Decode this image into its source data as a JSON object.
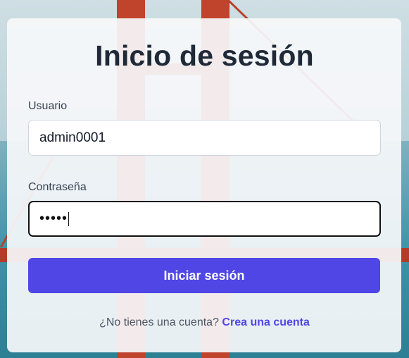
{
  "page": {
    "title": "Inicio de sesión"
  },
  "form": {
    "username_label": "Usuario",
    "username_value": "admin0001",
    "password_label": "Contraseña",
    "password_masked": "•••••",
    "submit_label": "Iniciar sesión"
  },
  "footer": {
    "prompt": "¿No tienes una cuenta?",
    "link": "Crea una cuenta"
  },
  "colors": {
    "accent": "#4f46e5",
    "title": "#1f2937",
    "card": "#f6f8fa"
  }
}
